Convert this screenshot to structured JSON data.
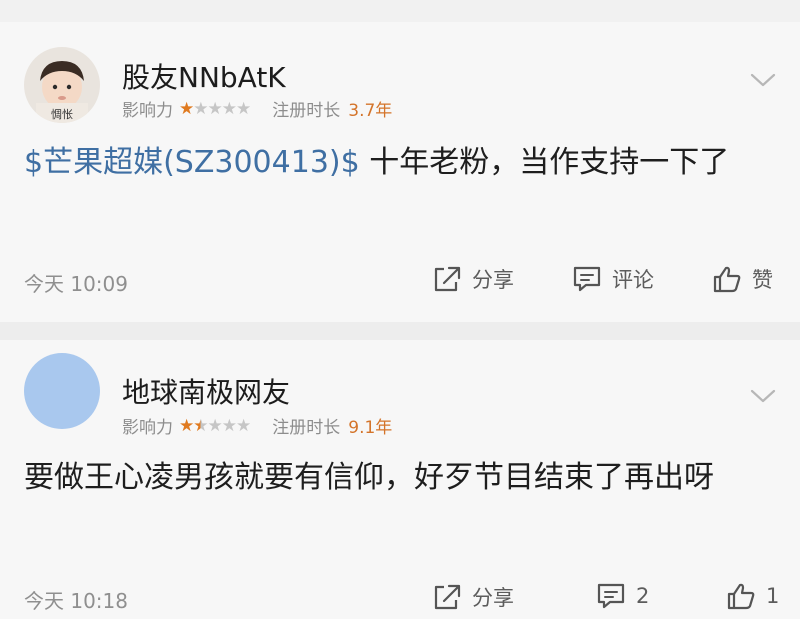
{
  "comments": [
    {
      "username": "股友NNbAtK",
      "avatar_label": "惆怅",
      "influence_label": "影响力",
      "influence_stars": 1,
      "registered_label": "注册时长",
      "registered_value": "3.7年",
      "stock_tag": "$芒果超媒(SZ300413)$",
      "text": " 十年老粉，当作支持一下了",
      "time": "今天 10:09",
      "share_label": "分享",
      "comment_label": "评论",
      "like_label": "赞"
    },
    {
      "username": "地球南极网友",
      "influence_label": "影响力",
      "influence_stars": 1.5,
      "registered_label": "注册时长",
      "registered_value": "9.1年",
      "text": "要做王心凌男孩就要有信仰，好歹节目结束了再出呀",
      "time": "今天 10:18",
      "share_label": "分享",
      "comment_count": "2",
      "like_count": "1"
    }
  ],
  "colors": {
    "stock_link": "#3f6fa3",
    "star_active": "#e07a1f",
    "registered_value": "#d4742a",
    "avatar_blue": "#a9c8ee"
  },
  "icons": [
    "chevron-down-icon",
    "share-icon",
    "comment-icon",
    "thumbs-up-icon",
    "star-icon"
  ]
}
